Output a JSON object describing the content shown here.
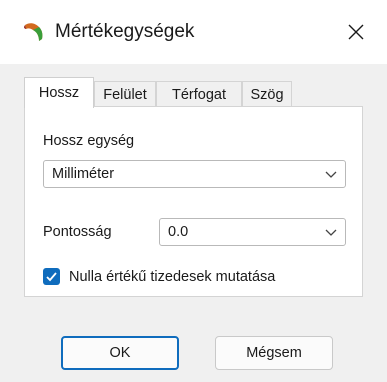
{
  "window": {
    "title": "Mértékegységek",
    "app_icon": "app-logo-icon",
    "close_icon": "close-icon"
  },
  "tabs": [
    {
      "label": "Hossz",
      "active": true
    },
    {
      "label": "Felület",
      "active": false
    },
    {
      "label": "Térfogat",
      "active": false
    },
    {
      "label": "Szög",
      "active": false
    }
  ],
  "length_panel": {
    "unit_label": "Hossz egység",
    "unit_value": "Milliméter",
    "precision_label": "Pontosság",
    "precision_value": "0.0",
    "show_zeros_label": "Nulla értékű tizedesek mutatása",
    "show_zeros_checked": true
  },
  "buttons": {
    "ok": "OK",
    "cancel": "Mégsem"
  },
  "colors": {
    "accent": "#0f6cbd",
    "dialog_background": "#f0f0f0",
    "panel_background": "#ffffff"
  }
}
